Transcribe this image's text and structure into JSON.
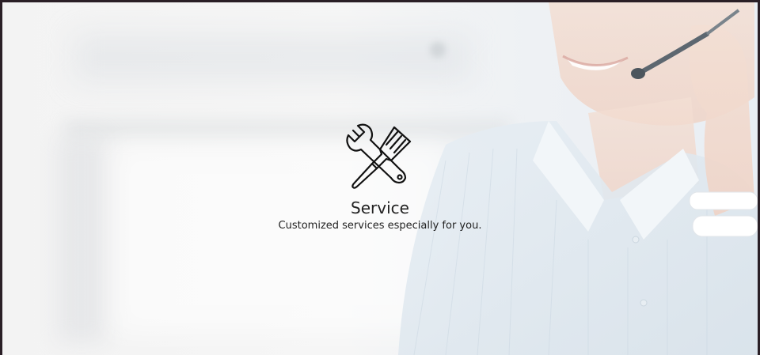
{
  "hero": {
    "icon": "wrench-screwdriver-icon",
    "title": "Service",
    "subtitle": "Customized services especially for you."
  },
  "colors": {
    "frame": "#2a1f26",
    "text": "#222222",
    "headset": "#5d6770",
    "shirt": "#dfe7ee",
    "skin": "#f1d6c8"
  }
}
